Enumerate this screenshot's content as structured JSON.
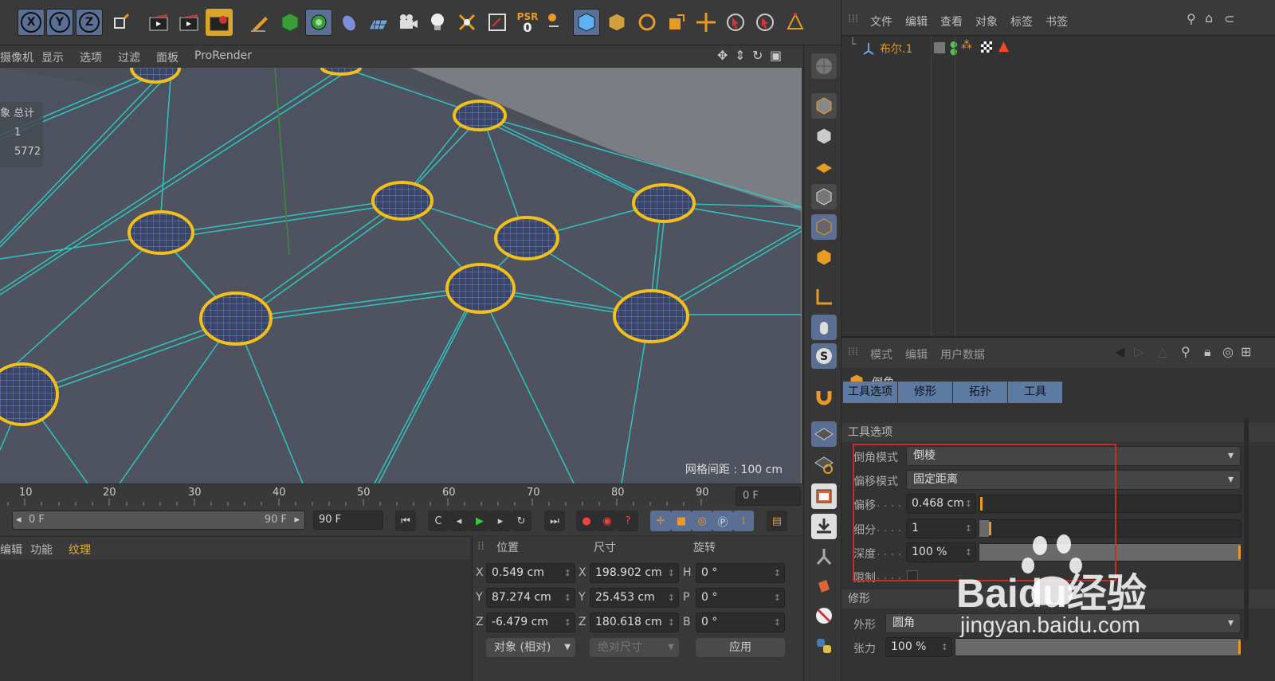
{
  "toolbar": {
    "xyz": [
      "X",
      "Y",
      "Z"
    ],
    "psr_label": "PSR",
    "psr_value": "0"
  },
  "viewport_menu": [
    "摄像机",
    "显示",
    "选项",
    "过滤",
    "面板",
    "ProRender"
  ],
  "viewport": {
    "hud_header": "象 总计",
    "hud_row1": "1",
    "hud_row2": "5772",
    "grid_distance": "网格间距 : 100 cm"
  },
  "timeline": {
    "ticks": [
      "10",
      "20",
      "30",
      "40",
      "50",
      "60",
      "70",
      "80",
      "90"
    ],
    "current_frame": "0 F"
  },
  "transport": {
    "range_start": "0 F",
    "range_end": "90 F",
    "end_field": "90 F"
  },
  "material_bar": [
    "编辑",
    "功能",
    "纹理"
  ],
  "coordinates": {
    "headers": [
      "位置",
      "尺寸",
      "旋转"
    ],
    "position": {
      "X": "0.549 cm",
      "Y": "87.274 cm",
      "Z": "-6.479 cm"
    },
    "size": {
      "X": "198.902 cm",
      "Y": "25.453 cm",
      "Z": "180.618 cm"
    },
    "rotation": {
      "H": "0 °",
      "P": "0 °",
      "B": "0 °"
    },
    "axis_labels": [
      "X",
      "Y",
      "Z"
    ],
    "rot_labels": [
      "H",
      "P",
      "B"
    ],
    "mode_dropdown": "对象 (相对)",
    "size_dropdown": "绝对尺寸",
    "apply_button": "应用"
  },
  "object_manager": {
    "menu": [
      "文件",
      "编辑",
      "查看",
      "对象",
      "标签",
      "书签"
    ],
    "object_name": "布尔.1"
  },
  "attributes": {
    "menu": [
      "模式",
      "编辑",
      "用户数据"
    ],
    "tool_title": "倒角",
    "tabs": [
      "工具选项",
      "修形",
      "拓扑",
      "工具"
    ],
    "section_tool": "工具选项",
    "bevel_mode_label": "倒角模式",
    "bevel_mode_value": "倒棱",
    "offset_mode_label": "偏移模式",
    "offset_mode_value": "固定距离",
    "offset_label": "偏移",
    "offset_value": "0.468 cm",
    "subdiv_label": "细分",
    "subdiv_value": "1",
    "depth_label": "深度",
    "depth_value": "100 %",
    "limit_label": "限制",
    "section_shaping": "修形",
    "shape_label": "外形",
    "shape_value": "圆角",
    "tension_label": "张力",
    "tension_value": "100 %"
  },
  "watermark": {
    "brand_text": "Baidu经验",
    "url": "jingyan.baidu.com"
  },
  "colors": {
    "accent_orange": "#e89a26",
    "tab_blue": "#5d7aa3",
    "wire_cyan": "#2fc4c0",
    "highlight_yellow": "#f2c018",
    "selection_red": "#c92b2b"
  }
}
